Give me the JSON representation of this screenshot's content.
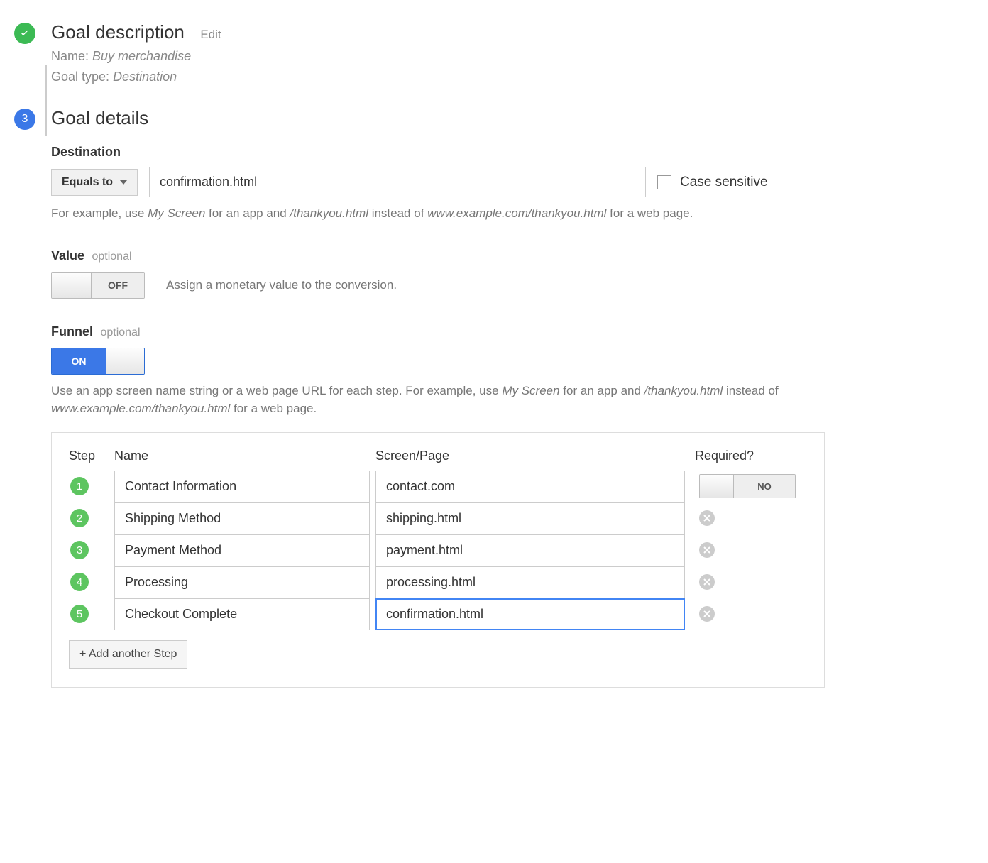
{
  "goal_description": {
    "title": "Goal description",
    "edit_label": "Edit",
    "name_label": "Name:",
    "name_value": "Buy merchandise",
    "type_label": "Goal type:",
    "type_value": "Destination"
  },
  "goal_details": {
    "step_number": "3",
    "title": "Goal details",
    "destination": {
      "heading": "Destination",
      "match_type": "Equals to",
      "input_value": "confirmation.html",
      "case_sensitive_label": "Case sensitive",
      "hint_parts": {
        "p1": "For example, use ",
        "i1": "My Screen",
        "p2": " for an app and ",
        "i2": "/thankyou.html",
        "p3": " instead of ",
        "i3": "www.example.com/thankyou.html",
        "p4": " for a web page."
      }
    },
    "value": {
      "label": "Value",
      "optional": "optional",
      "state": "OFF",
      "description": "Assign a monetary value to the conversion."
    },
    "funnel": {
      "label": "Funnel",
      "optional": "optional",
      "state": "ON",
      "hint_parts": {
        "p1": "Use an app screen name string or a web page URL for each step. For example, use ",
        "i1": "My Screen",
        "p2": " for an app and ",
        "i2": "/thankyou.html",
        "p3": " instead of ",
        "i3": "www.example.com/thankyou.html",
        "p4": " for a web page."
      },
      "columns": {
        "step": "Step",
        "name": "Name",
        "page": "Screen/Page",
        "required": "Required?"
      },
      "required_state": "NO",
      "steps": [
        {
          "num": "1",
          "name": "Contact Information",
          "page": "contact.com"
        },
        {
          "num": "2",
          "name": "Shipping Method",
          "page": "shipping.html"
        },
        {
          "num": "3",
          "name": "Payment Method",
          "page": "payment.html"
        },
        {
          "num": "4",
          "name": "Processing",
          "page": "processing.html"
        },
        {
          "num": "5",
          "name": "Checkout Complete",
          "page": "confirmation.html"
        }
      ],
      "add_step_label": "+ Add another Step"
    }
  }
}
